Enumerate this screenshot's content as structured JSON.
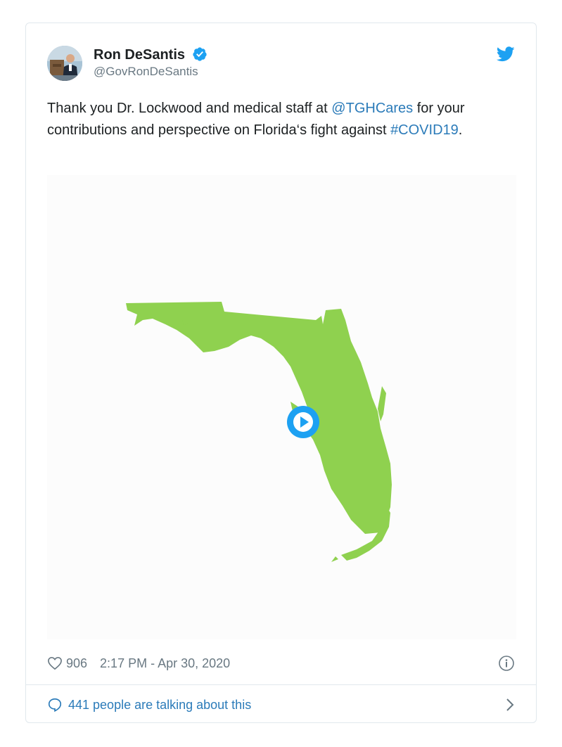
{
  "tweet": {
    "author_name": "Ron DeSantis",
    "author_handle": "@GovRonDeSantis",
    "text_part1": "Thank you Dr. Lockwood and medical staff at ",
    "mention": "@TGHCares",
    "text_part2": " for your contributions and perspective on Florida‘s fight against ",
    "hashtag": "#COVID19",
    "text_part3": ".",
    "like_count": "906",
    "timestamp": "2:17 PM - Apr 30, 2020",
    "talking_text": "441 people are talking about this"
  },
  "icons": {
    "verified": "verified-badge-icon",
    "brand": "twitter-bird-icon",
    "play": "play-icon",
    "like": "heart-icon",
    "info": "info-icon",
    "reply": "speech-bubble-icon",
    "more": "chevron-right-icon"
  },
  "colors": {
    "link": "#2b7bb9",
    "twitter_blue": "#1da1f2",
    "map_fill": "#8fd14f",
    "muted_text": "#697882",
    "border": "#e1e8ed"
  }
}
